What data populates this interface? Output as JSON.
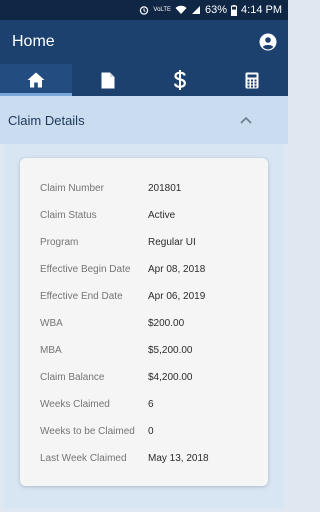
{
  "status_bar": {
    "volte": "VoLTE",
    "battery": "63%",
    "time": "4:14 PM"
  },
  "app_bar": {
    "title": "Home"
  },
  "tabs": [
    {
      "name": "home",
      "icon": "home-icon",
      "active": true
    },
    {
      "name": "document",
      "icon": "document-icon",
      "active": false
    },
    {
      "name": "payments",
      "icon": "dollar-icon",
      "active": false
    },
    {
      "name": "calculator",
      "icon": "calculator-icon",
      "active": false
    }
  ],
  "section": {
    "title": "Claim Details"
  },
  "claim_details": [
    {
      "label": "Claim Number",
      "value": "201801"
    },
    {
      "label": "Claim Status",
      "value": "Active"
    },
    {
      "label": "Program",
      "value": "Regular UI"
    },
    {
      "label": "Effective Begin Date",
      "value": "Apr 08, 2018"
    },
    {
      "label": "Effective End Date",
      "value": "Apr 06, 2019"
    },
    {
      "label": "WBA",
      "value": "$200.00"
    },
    {
      "label": "MBA",
      "value": "$5,200.00"
    },
    {
      "label": "Claim Balance",
      "value": "$4,200.00"
    },
    {
      "label": "Weeks Claimed",
      "value": "6"
    },
    {
      "label": "Weeks to be Claimed",
      "value": "0"
    },
    {
      "label": "Last Week Claimed",
      "value": "May 13, 2018"
    }
  ],
  "colors": {
    "status_bar": "#0f2745",
    "app_bar": "#1c416f",
    "section_header": "#c9dcf0",
    "card": "#f5f5f5"
  }
}
